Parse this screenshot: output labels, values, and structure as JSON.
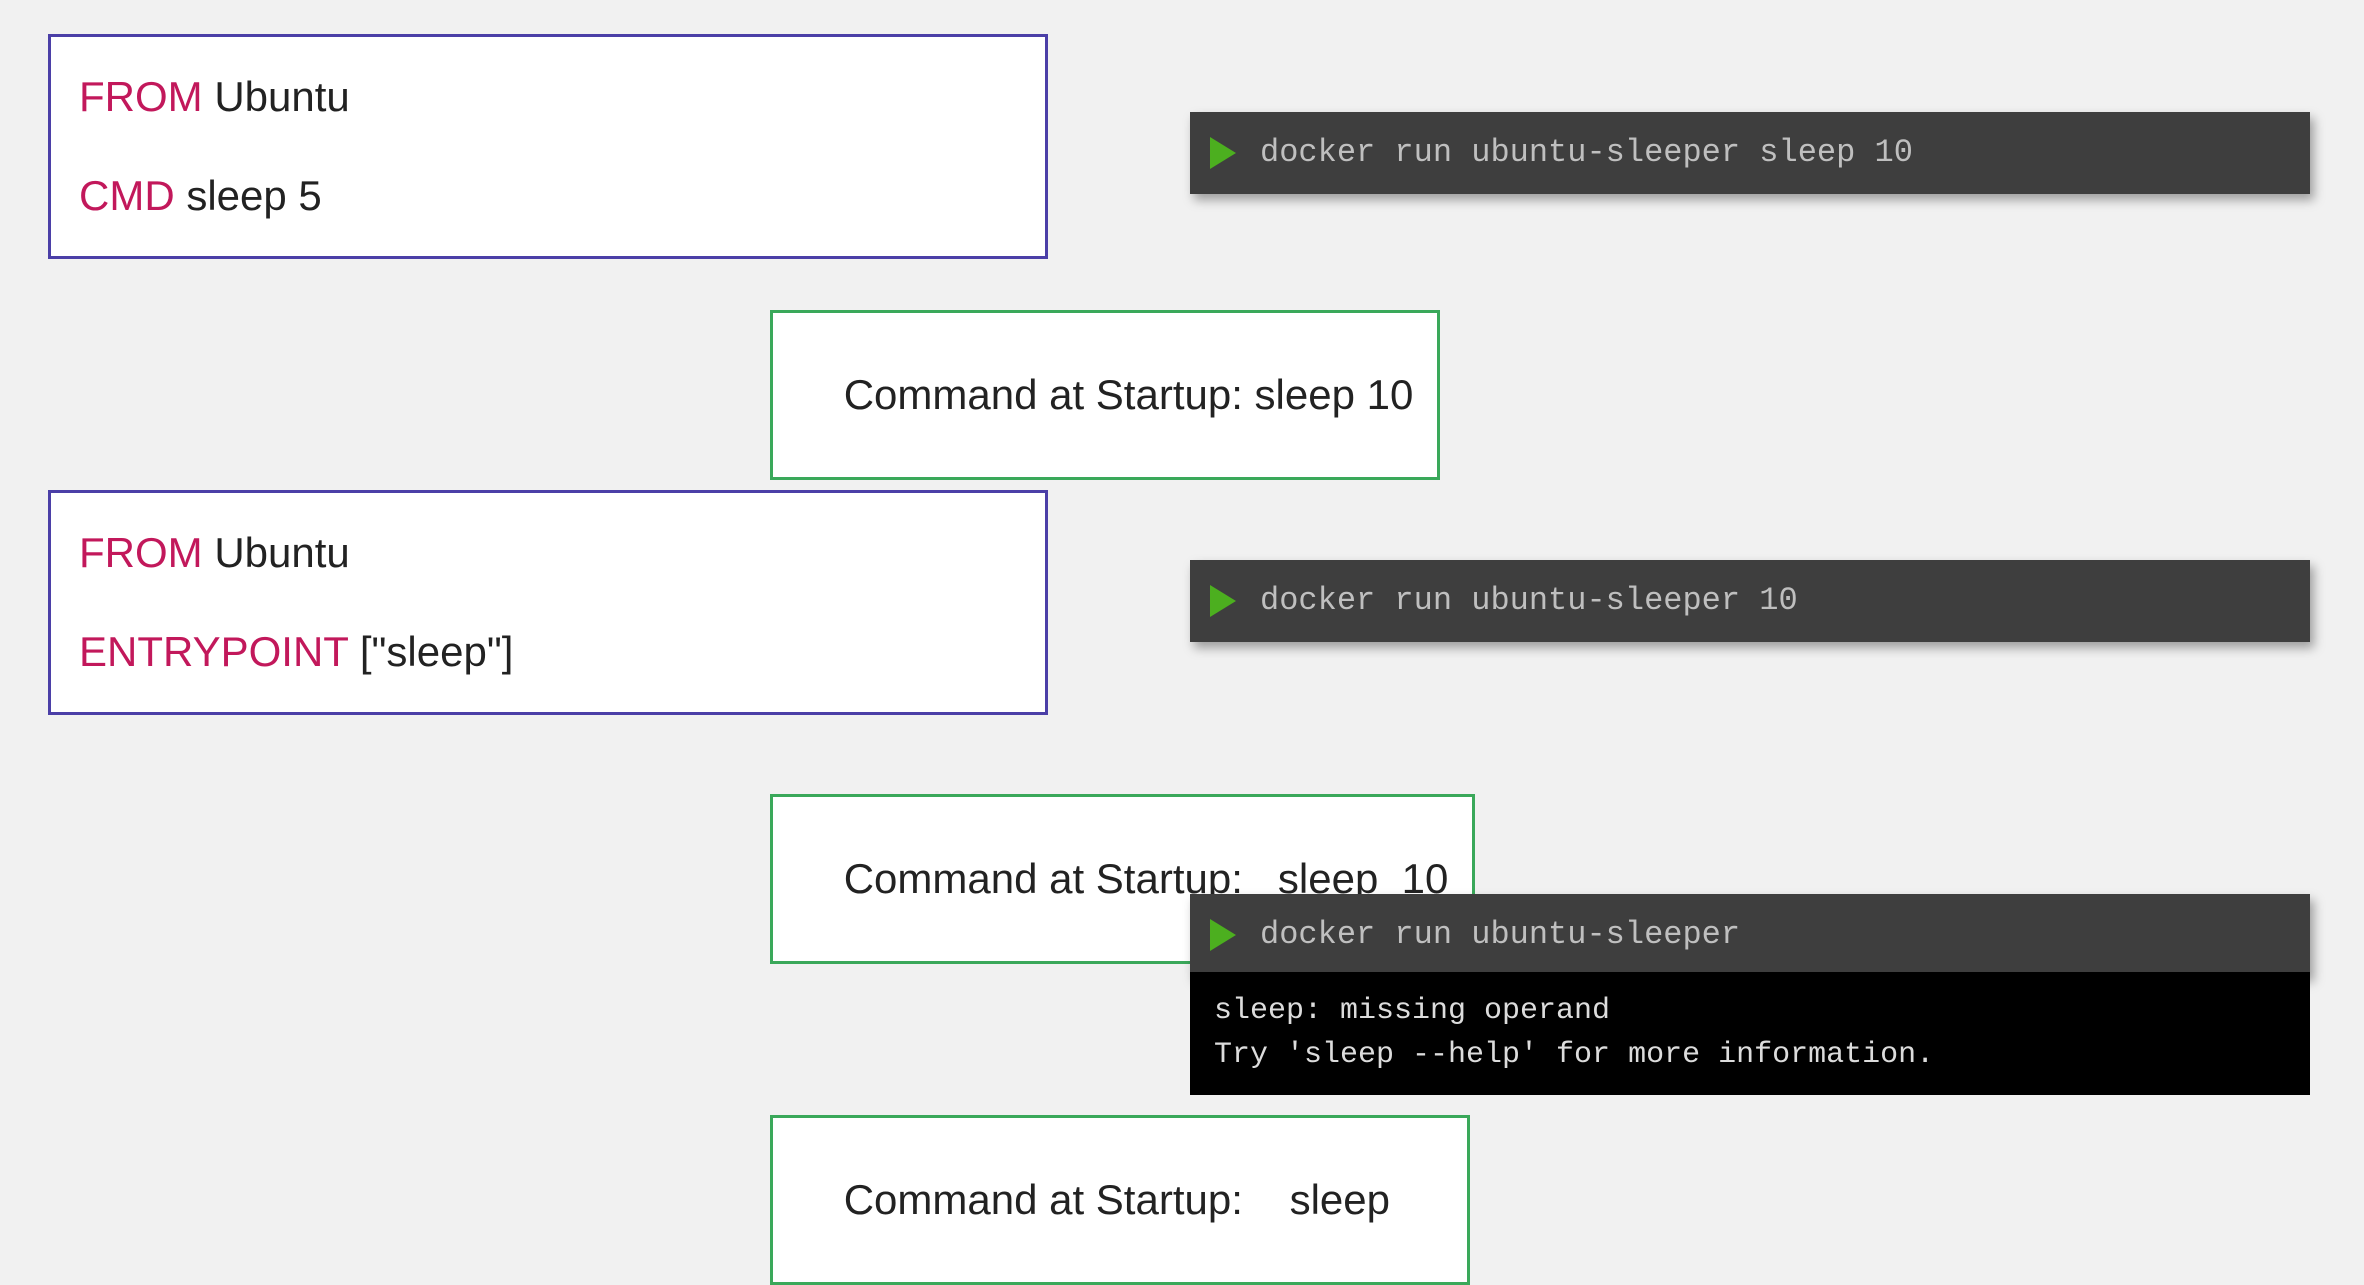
{
  "dockerfile1": {
    "keyword1": "FROM",
    "arg1": " Ubuntu",
    "keyword2": "CMD",
    "arg2": " sleep 5"
  },
  "dockerfile2": {
    "keyword1": "FROM",
    "arg1": " Ubuntu",
    "keyword2": "ENTRYPOINT",
    "arg2": " [\"sleep\"]"
  },
  "terminals": {
    "t1": "docker run ubuntu-sleeper sleep 10",
    "t2": "docker run ubuntu-sleeper 10",
    "t3": "docker run ubuntu-sleeper"
  },
  "output3": "sleep: missing operand\nTry 'sleep --help' for more information.",
  "startup": {
    "s1_label": "Command at Startup: ",
    "s1_value": "sleep 10",
    "s2_label": "Command at Startup:   ",
    "s2_cmd": "sleep",
    "s2_arg": "  10",
    "s3_label": "Command at Startup:    ",
    "s3_cmd": "sleep"
  }
}
